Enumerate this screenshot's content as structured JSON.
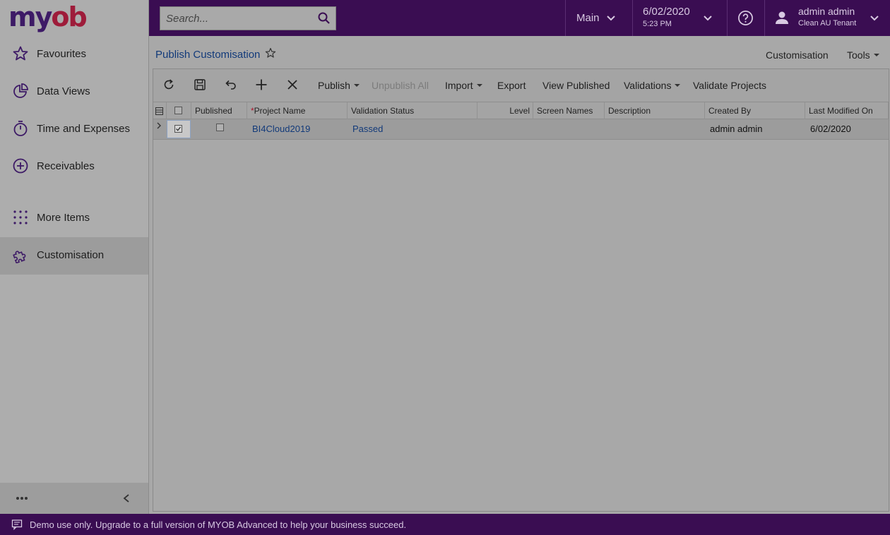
{
  "brand": {
    "logo_a": "my",
    "logo_b": "ob"
  },
  "search": {
    "placeholder": "Search..."
  },
  "header": {
    "main_label": "Main",
    "date": "6/02/2020",
    "time": "5:23 PM",
    "user_name": "admin admin",
    "tenant": "Clean AU Tenant"
  },
  "sidebar": {
    "items": [
      {
        "label": "Favourites",
        "icon": "star-icon"
      },
      {
        "label": "Data Views",
        "icon": "pie-chart-icon"
      },
      {
        "label": "Time and Expenses",
        "icon": "stopwatch-icon"
      },
      {
        "label": "Receivables",
        "icon": "plus-circle-icon"
      },
      {
        "label": "More Items",
        "icon": "grid-dots-icon"
      },
      {
        "label": "Customisation",
        "icon": "puzzle-icon"
      }
    ],
    "active": "Customisation"
  },
  "page": {
    "title": "Publish Customisation",
    "links": {
      "customisation": "Customisation",
      "tools": "Tools"
    }
  },
  "toolbar": {
    "publish": "Publish",
    "unpublish_all": "Unpublish All",
    "import": "Import",
    "export": "Export",
    "view_published": "View Published",
    "validations": "Validations",
    "validate_projects": "Validate Projects"
  },
  "grid": {
    "columns": {
      "published": "Published",
      "project_name": "Project Name",
      "validation_status": "Validation Status",
      "level": "Level",
      "screen_names": "Screen Names",
      "description": "Description",
      "created_by": "Created By",
      "last_modified_on": "Last Modified On"
    },
    "required_marker": "*",
    "rows": [
      {
        "selected": true,
        "published": false,
        "project_name": "BI4Cloud2019",
        "validation_status": "Passed",
        "level": "",
        "screen_names": "",
        "description": "",
        "created_by": "admin admin",
        "last_modified_on": "6/02/2020"
      }
    ]
  },
  "footer": {
    "message": "Demo use only. Upgrade to a full version of MYOB Advanced to help your business succeed."
  },
  "colors": {
    "brand_purple": "#3a0d52",
    "link_blue": "#123a7a",
    "logo_red": "#9e1c3a"
  }
}
